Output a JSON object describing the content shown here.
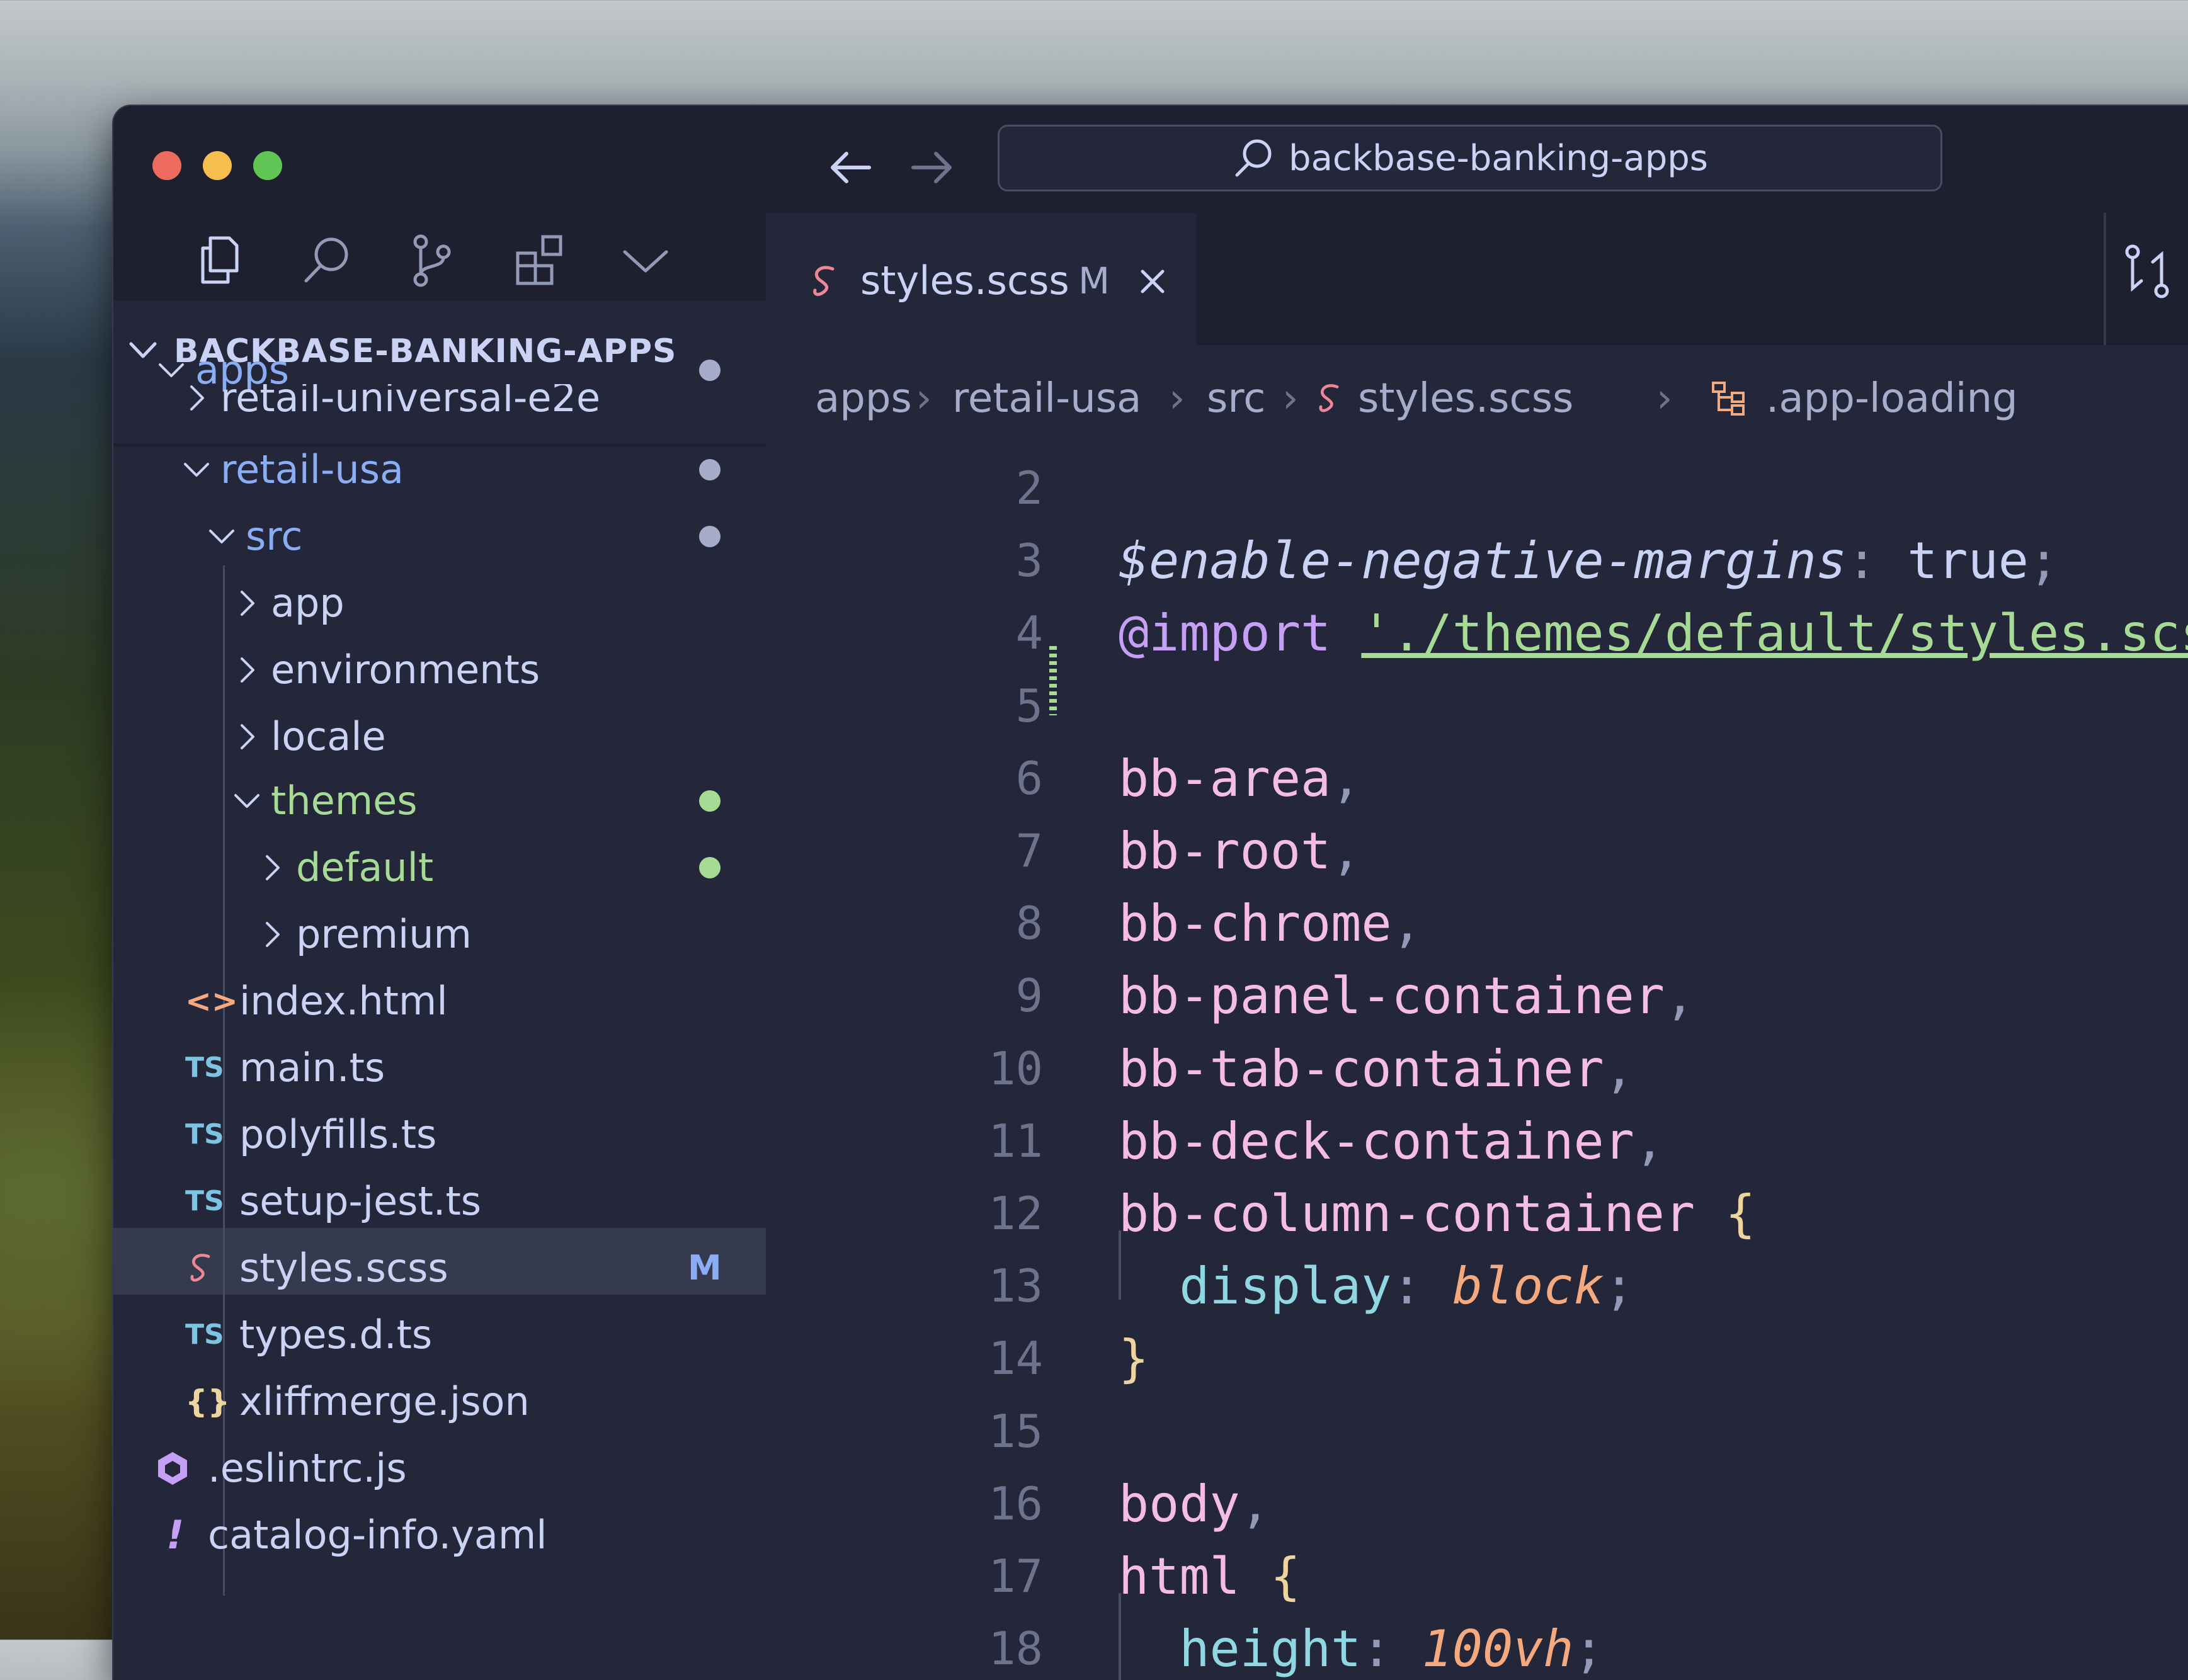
{
  "window": {
    "search_text": "backbase-banking-apps"
  },
  "explorer": {
    "section_title": "BACKBASE-BANKING-APPS",
    "items": [
      {
        "label": "apps",
        "kind": "folder-open",
        "status": "dot"
      },
      {
        "label": "retail-universal-e2e",
        "kind": "folder-closed"
      },
      {
        "label": "retail-usa",
        "kind": "folder-open",
        "status": "dot"
      },
      {
        "label": "src",
        "kind": "folder-open",
        "status": "dot"
      },
      {
        "label": "app",
        "kind": "folder-closed"
      },
      {
        "label": "environments",
        "kind": "folder-closed"
      },
      {
        "label": "locale",
        "kind": "folder-closed"
      },
      {
        "label": "themes",
        "kind": "folder-open",
        "status": "dot-green"
      },
      {
        "label": "default",
        "kind": "folder-closed",
        "status": "dot-green"
      },
      {
        "label": "premium",
        "kind": "folder-closed"
      },
      {
        "label": "index.html",
        "kind": "file-html"
      },
      {
        "label": "main.ts",
        "kind": "file-ts"
      },
      {
        "label": "polyfills.ts",
        "kind": "file-ts"
      },
      {
        "label": "setup-jest.ts",
        "kind": "file-ts"
      },
      {
        "label": "styles.scss",
        "kind": "file-scss",
        "status": "M",
        "selected": true
      },
      {
        "label": "types.d.ts",
        "kind": "file-ts"
      },
      {
        "label": "xliffmerge.json",
        "kind": "file-json"
      },
      {
        "label": ".eslintrc.js",
        "kind": "file-eslint"
      },
      {
        "label": "catalog-info.yaml",
        "kind": "file-yaml"
      }
    ],
    "ts_badge": "TS",
    "json_badge": "{}",
    "yaml_badge": "!",
    "html_badge": "<>"
  },
  "tab": {
    "label": "styles.scss",
    "status": "M"
  },
  "breadcrumb": [
    "apps",
    "retail-usa",
    "src",
    "styles.scss",
    ".app-loading"
  ],
  "editor": {
    "lines": [
      {
        "n": "2",
        "tokens": []
      },
      {
        "n": "3",
        "tokens": [
          [
            "var",
            "$enable-negative-margins"
          ],
          [
            "punc",
            ": "
          ],
          [
            "plain",
            "true"
          ],
          [
            "punc",
            ";"
          ]
        ]
      },
      {
        "n": "4",
        "tokens": [
          [
            "kw",
            "@import"
          ],
          [
            "plain",
            " "
          ],
          [
            "str",
            "'./themes/default/styles.scss'"
          ],
          [
            "punc",
            ";"
          ]
        ]
      },
      {
        "n": "5",
        "tokens": []
      },
      {
        "n": "6",
        "tokens": [
          [
            "sel",
            "bb-area"
          ],
          [
            "punc",
            ","
          ]
        ]
      },
      {
        "n": "7",
        "tokens": [
          [
            "sel",
            "bb-root"
          ],
          [
            "punc",
            ","
          ]
        ]
      },
      {
        "n": "8",
        "tokens": [
          [
            "sel",
            "bb-chrome"
          ],
          [
            "punc",
            ","
          ]
        ]
      },
      {
        "n": "9",
        "tokens": [
          [
            "sel",
            "bb-panel-container"
          ],
          [
            "punc",
            ","
          ]
        ]
      },
      {
        "n": "10",
        "tokens": [
          [
            "sel",
            "bb-tab-container"
          ],
          [
            "punc",
            ","
          ]
        ]
      },
      {
        "n": "11",
        "tokens": [
          [
            "sel",
            "bb-deck-container"
          ],
          [
            "punc",
            ","
          ]
        ]
      },
      {
        "n": "12",
        "tokens": [
          [
            "sel",
            "bb-column-container"
          ],
          [
            "plain",
            " "
          ],
          [
            "brace",
            "{"
          ]
        ]
      },
      {
        "n": "13",
        "tokens": [
          [
            "plain",
            "  "
          ],
          [
            "prop",
            "display"
          ],
          [
            "punc",
            ": "
          ],
          [
            "val",
            "block"
          ],
          [
            "punc",
            ";"
          ]
        ]
      },
      {
        "n": "14",
        "tokens": [
          [
            "brace",
            "}"
          ]
        ]
      },
      {
        "n": "15",
        "tokens": []
      },
      {
        "n": "16",
        "tokens": [
          [
            "sel",
            "body"
          ],
          [
            "punc",
            ","
          ]
        ]
      },
      {
        "n": "17",
        "tokens": [
          [
            "sel",
            "html"
          ],
          [
            "plain",
            " "
          ],
          [
            "brace",
            "{"
          ]
        ]
      },
      {
        "n": "18",
        "tokens": [
          [
            "plain",
            "  "
          ],
          [
            "prop",
            "height"
          ],
          [
            "punc",
            ": "
          ],
          [
            "val",
            "100vh"
          ],
          [
            "punc",
            ";"
          ]
        ]
      }
    ]
  },
  "colors": {
    "folder_blue": "#8aadf4",
    "folder_green": "#a6da95",
    "file_text": "#cad3f5",
    "ts_badge": "#7dc4e4",
    "scss_icon": "#ed8796",
    "html_icon": "#f5a97f",
    "json_icon": "#eed49f",
    "eslint_icon": "#c6a0f6",
    "yaml_icon": "#c6a0f6"
  }
}
